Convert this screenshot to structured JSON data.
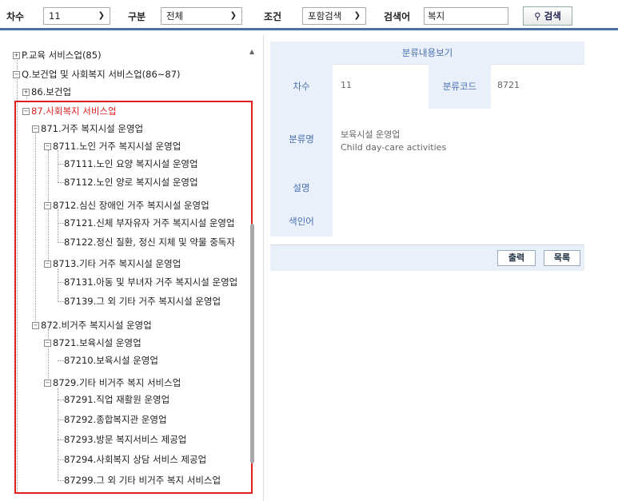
{
  "search_bar": {
    "order_label": "차수",
    "order_value": "11",
    "category_label": "구분",
    "category_value": "전체",
    "condition_label": "조건",
    "condition_value": "포함검색",
    "keyword_label": "검색어",
    "keyword_value": "복지",
    "search_button": "검색"
  },
  "tree": [
    {
      "code": "P.",
      "label": "교육 서비스업(85)"
    },
    {
      "code": "Q.",
      "label": "보건업 및 사회복지 서비스업(86~87)"
    },
    {
      "code": "86.",
      "label": "보건업"
    },
    {
      "code": "87.",
      "label": "사회복지 서비스업"
    },
    {
      "code": "871.",
      "label": "거주 복지시설 운영업"
    },
    {
      "code": "8711.",
      "label": "노인 거주 복지시설 운영업"
    },
    {
      "code": "87111.",
      "label": "노인 요양 복지시설 운영업"
    },
    {
      "code": "87112.",
      "label": "노인 양로 복지시설 운영업"
    },
    {
      "code": "8712.",
      "label": "심신 장애인 거주 복지시설 운영업"
    },
    {
      "code": "87121.",
      "label": "신체 부자유자 거주 복지시설 운영업"
    },
    {
      "code": "87122.",
      "label": "정신 질환, 정신 지체 및 약물 중독자"
    },
    {
      "code": "8713.",
      "label": "기타 거주 복지시설 운영업"
    },
    {
      "code": "87131.",
      "label": "아동 및 부녀자 거주 복지시설 운영업"
    },
    {
      "code": "87139.",
      "label": "그 외 기타 거주 복지시설 운영업"
    },
    {
      "code": "872.",
      "label": "비거주 복지시설 운영업"
    },
    {
      "code": "8721.",
      "label": "보육시설 운영업"
    },
    {
      "code": "87210.",
      "label": "보육시설 운영업"
    },
    {
      "code": "8729.",
      "label": "기타 비거주 복지 서비스업"
    },
    {
      "code": "87291.",
      "label": "직업 재활원 운영업"
    },
    {
      "code": "87292.",
      "label": "종합복지관 운영업"
    },
    {
      "code": "87293.",
      "label": "방문 복지서비스 제공업"
    },
    {
      "code": "87294.",
      "label": "사회복지 상담 서비스 제공업"
    },
    {
      "code": "87299.",
      "label": "그 외 기타 비거주 복지 서비스업"
    }
  ],
  "detail": {
    "header": "분류내용보기",
    "order_label": "차수",
    "order_value": "11",
    "code_label": "분류코드",
    "code_value": "8721",
    "name_label": "분류명",
    "name_ko": "보육시설 운영업",
    "name_en": "Child day-care activities",
    "desc_label": "설명",
    "index_label": "색인어",
    "print_button": "출력",
    "list_button": "목록"
  },
  "colors": {
    "accent": "#4a70b0",
    "highlight": "#e02020",
    "panel_bg": "#e9f0fa"
  }
}
